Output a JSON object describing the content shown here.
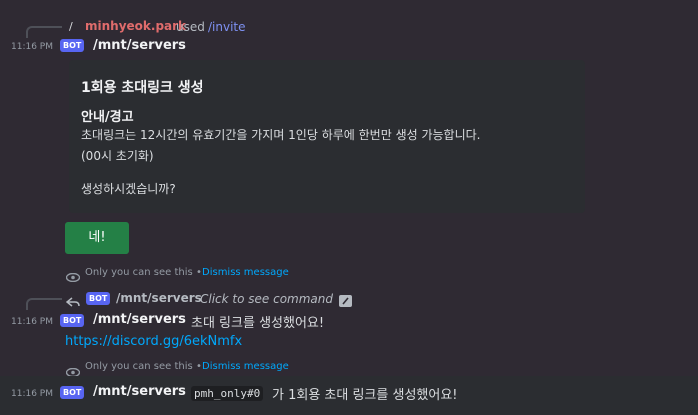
{
  "m1": {
    "reply_slash": "/",
    "reply_user": "minhyeok.park",
    "reply_used": "used",
    "reply_command": "/invite",
    "timestamp": "11:16 PM",
    "badge": "BOT",
    "author": "/mnt/servers",
    "embed": {
      "title": "1회용 초대링크 생성",
      "field_name": "안내/경고",
      "line1": "초대링크는 12시간의 유효기간을 가지며 1인당 하루에 한번만 생성 가능합니다.",
      "line2": "(00시 초기화)",
      "line3": "생성하시겠습니까?"
    },
    "button_label": "네!",
    "ephemeral_text": "Only you can see this",
    "ephemeral_sep": "•",
    "dismiss": "Dismiss message"
  },
  "m2": {
    "reply_badge": "BOT",
    "reply_author": "/mnt/servers",
    "reply_text": "Click to see command",
    "timestamp": "11:16 PM",
    "badge": "BOT",
    "author": "/mnt/servers",
    "content": "초대 링크를 생성했어요!",
    "link": "https://discord.gg/6ekNmfx",
    "ephemeral_text": "Only you can see this",
    "ephemeral_sep": "•",
    "dismiss": "Dismiss message"
  },
  "m3": {
    "timestamp": "11:16 PM",
    "badge": "BOT",
    "author": "/mnt/servers",
    "mention": "pmh_only#0",
    "content": "가 1회용 초대 링크를 생성했어요!"
  }
}
